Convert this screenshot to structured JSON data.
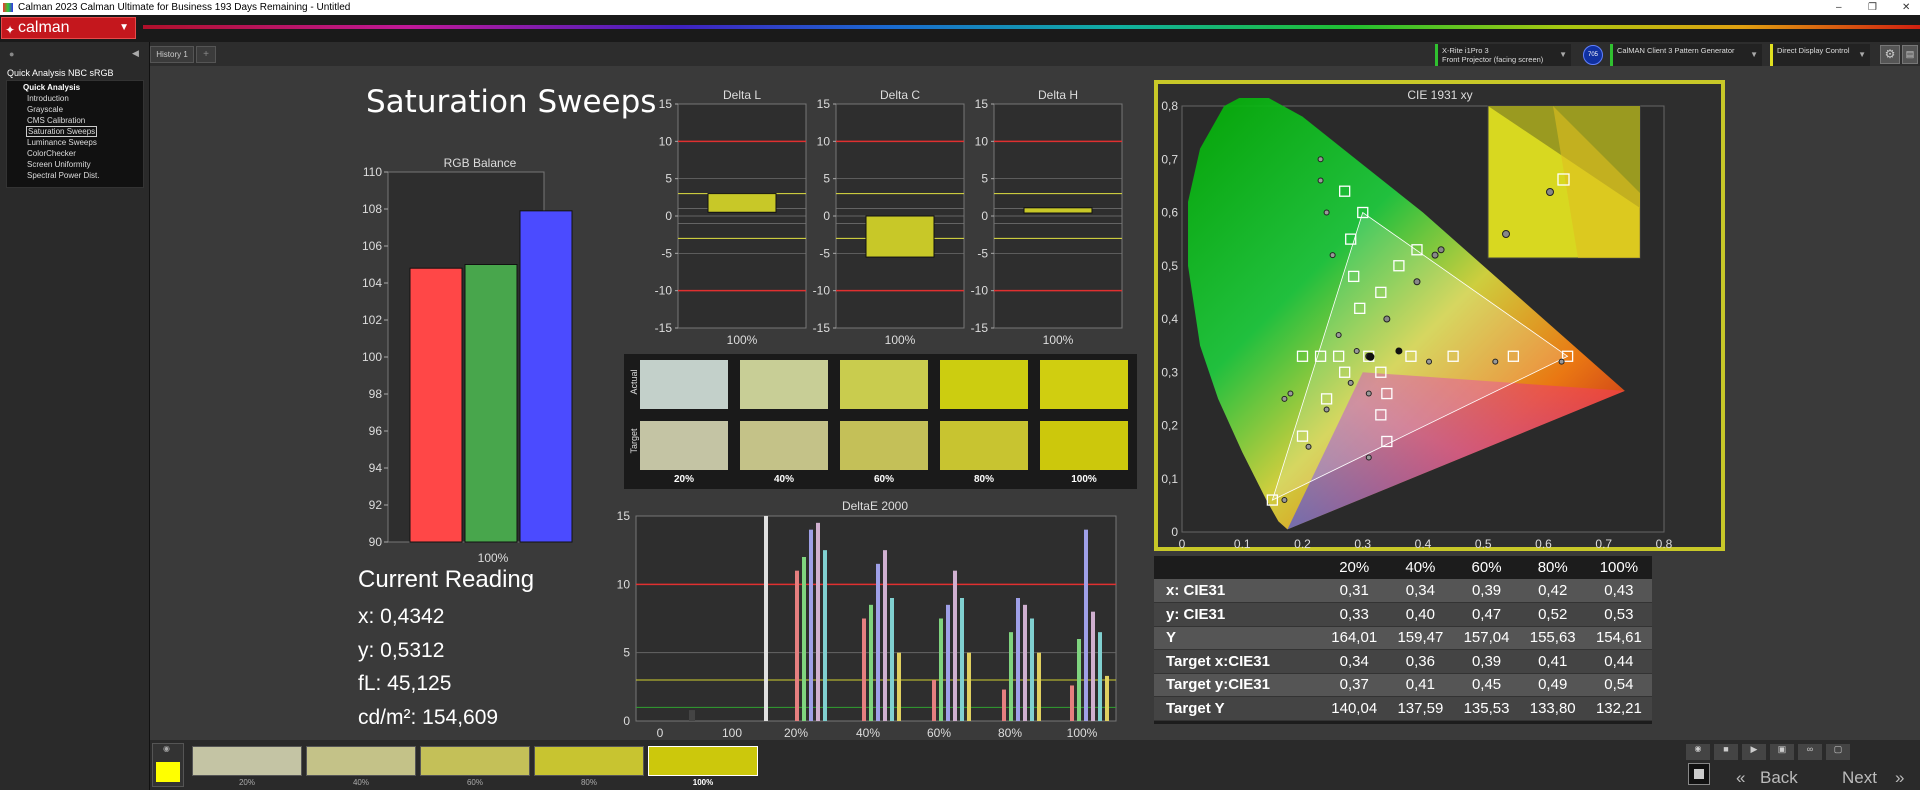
{
  "app": {
    "title": "Calman 2023 Calman Ultimate for Business 193 Days Remaining  - Untitled",
    "logo": "calman",
    "window_controls": [
      "–",
      "❐",
      "✕"
    ]
  },
  "sidebar": {
    "header": "Quick Analysis NBC sRGB",
    "group": "Quick Analysis",
    "items": [
      "Introduction",
      "Grayscale",
      "CMS Calibration",
      "Saturation Sweeps",
      "Luminance Sweeps",
      "ColorChecker",
      "Screen Uniformity",
      "Spectral Power Dist."
    ],
    "selected": "Saturation Sweeps"
  },
  "tabs": {
    "history": "History 1",
    "add": "+"
  },
  "devices": {
    "meter_line1": "X-Rite i1Pro 3",
    "meter_line2": "Front Projector (facing screen)",
    "meter_badge": "705",
    "generator": "CalMAN Client 3 Pattern Generator",
    "display": "Direct Display Control"
  },
  "page": {
    "title": "Saturation Sweeps"
  },
  "rgb_balance": {
    "title": "RGB Balance",
    "xlabel": "100%",
    "ylim": [
      90,
      110
    ],
    "yticks": [
      90,
      92,
      94,
      96,
      98,
      100,
      102,
      104,
      106,
      108,
      110
    ],
    "bars": [
      {
        "name": "R",
        "value": 104.8,
        "color": "#ff4747"
      },
      {
        "name": "G",
        "value": 105.0,
        "color": "#48a64c"
      },
      {
        "name": "B",
        "value": 107.9,
        "color": "#4b4bff"
      }
    ]
  },
  "delta_charts": [
    {
      "title": "Delta L",
      "value": 3.0,
      "low": 0.5,
      "xlabel": "100%"
    },
    {
      "title": "Delta C",
      "value": 0,
      "low": -5.5,
      "xlabel": "100%"
    },
    {
      "title": "Delta H",
      "value": 1.1,
      "low": 0.4,
      "xlabel": "100%"
    }
  ],
  "delta_yticks": [
    "15",
    "10",
    "5",
    "0",
    "-5",
    "-10",
    "-15"
  ],
  "swatches": {
    "actual_label": "Actual",
    "target_label": "Target",
    "labels": [
      "20%",
      "40%",
      "60%",
      "80%",
      "100%"
    ],
    "actual": [
      "#c3d0ca",
      "#c8ce96",
      "#c9cc4e",
      "#cccd10",
      "#d0ce10"
    ],
    "target": [
      "#c4c4a4",
      "#c4c288",
      "#c4c058",
      "#c8c430",
      "#ccc80c"
    ]
  },
  "reading": {
    "title": "Current Reading",
    "x": "x: 0,4342",
    "y": "y: 0,5312",
    "fl": "fL: 45,125",
    "cd": "cd/m²: 154,609"
  },
  "deltae": {
    "title": "DeltaE 2000",
    "xlabels": [
      "0",
      "100",
      "20%",
      "40%",
      "60%",
      "80%",
      "100%"
    ],
    "yticks": [
      "15",
      "10",
      "5",
      "0"
    ]
  },
  "cie": {
    "title": "CIE 1931 xy",
    "xticks": [
      "0",
      "0,1",
      "0,2",
      "0,3",
      "0,4",
      "0,5",
      "0,6",
      "0,7",
      "0,8"
    ],
    "yticks": [
      "0,8",
      "0,7",
      "0,6",
      "0,5",
      "0,4",
      "0,3",
      "0,2",
      "0,1",
      "0"
    ]
  },
  "table": {
    "headers": [
      "",
      "20%",
      "40%",
      "60%",
      "80%",
      "100%"
    ],
    "rows": [
      [
        "x: CIE31",
        "0,31",
        "0,34",
        "0,39",
        "0,42",
        "0,43"
      ],
      [
        "y: CIE31",
        "0,33",
        "0,40",
        "0,47",
        "0,52",
        "0,53"
      ],
      [
        "Y",
        "164,01",
        "159,47",
        "157,04",
        "155,63",
        "154,61"
      ],
      [
        "Target x:CIE31",
        "0,34",
        "0,36",
        "0,39",
        "0,41",
        "0,44"
      ],
      [
        "Target y:CIE31",
        "0,37",
        "0,41",
        "0,45",
        "0,49",
        "0,54"
      ],
      [
        "Target Y",
        "140,04",
        "137,59",
        "135,53",
        "133,80",
        "132,21"
      ]
    ]
  },
  "bottom": {
    "thumbs": [
      "20%",
      "40%",
      "60%",
      "80%",
      "100%"
    ],
    "thumb_colors": [
      "#c4c4a4",
      "#c4c288",
      "#c4c058",
      "#c8c430",
      "#ccc80c"
    ],
    "back": "Back",
    "next": "Next"
  },
  "chart_data": [
    {
      "type": "bar",
      "title": "RGB Balance",
      "categories": [
        "100%"
      ],
      "series": [],
      "values": [
        104.8,
        105.0,
        107.9
      ],
      "ylim": [
        90,
        110
      ]
    },
    {
      "type": "bar",
      "title": "Delta L",
      "categories": [
        "100%"
      ],
      "values": [
        3.0
      ],
      "ylim": [
        -15,
        15
      ]
    },
    {
      "type": "bar",
      "title": "Delta C",
      "categories": [
        "100%"
      ],
      "values": [
        -4.5
      ],
      "ylim": [
        -15,
        15
      ]
    },
    {
      "type": "bar",
      "title": "Delta H",
      "categories": [
        "100%"
      ],
      "values": [
        0.9
      ],
      "ylim": [
        -15,
        15
      ]
    },
    {
      "type": "scatter",
      "title": "CIE 1931 xy",
      "xlim": [
        0,
        0.8
      ],
      "ylim": [
        0,
        0.8
      ],
      "series": [
        {
          "name": "",
          "x": [
            0.31,
            0.34,
            0.39,
            0.42,
            0.43
          ],
          "y": [
            0.33,
            0.4,
            0.47,
            0.52,
            0.53
          ]
        }
      ]
    }
  ]
}
